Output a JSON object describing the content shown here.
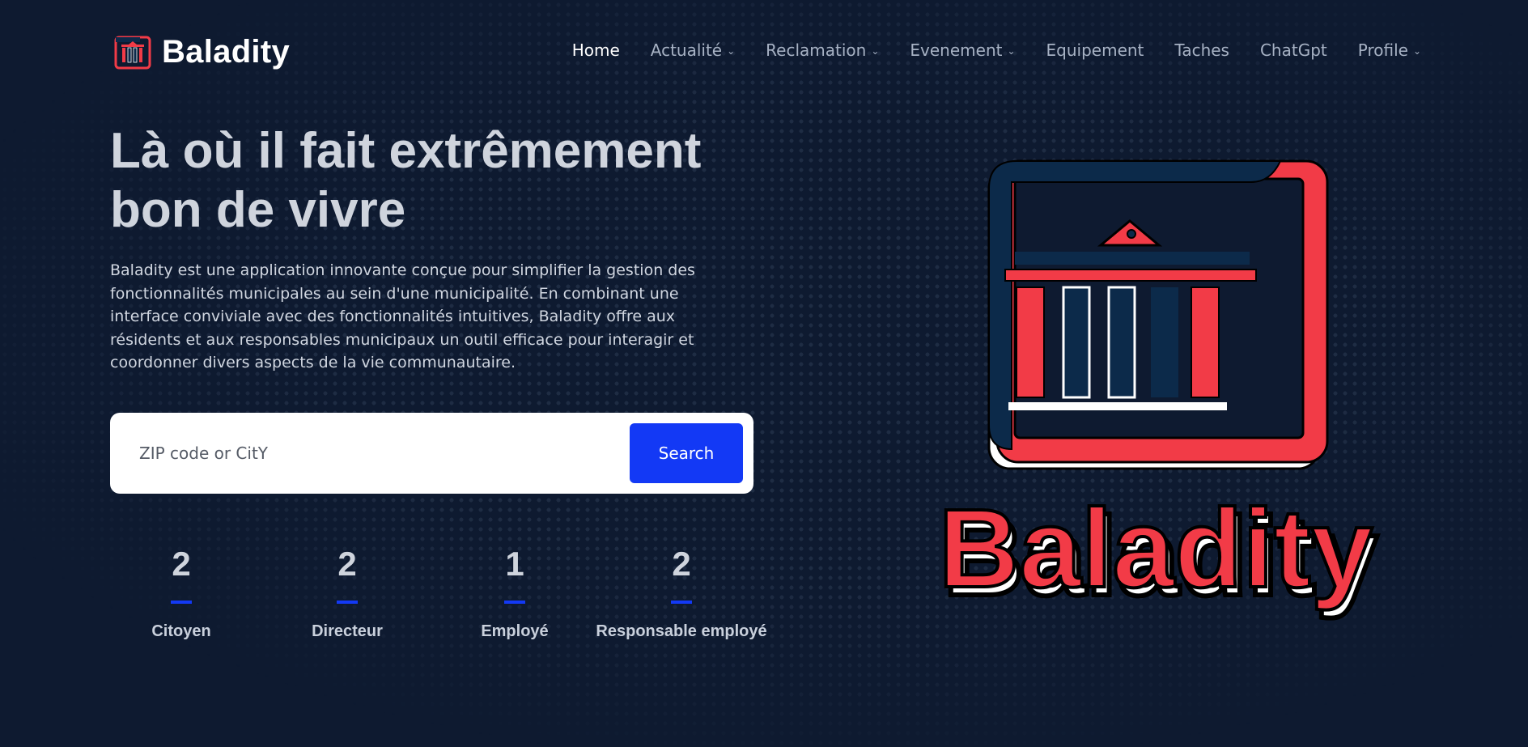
{
  "brand": {
    "name": "Baladity",
    "logo_icon": "city-hall-icon"
  },
  "nav": {
    "items": [
      {
        "label": "Home",
        "active": true,
        "has_dropdown": false
      },
      {
        "label": "Actualité",
        "active": false,
        "has_dropdown": true
      },
      {
        "label": "Reclamation",
        "active": false,
        "has_dropdown": true
      },
      {
        "label": "Evenement",
        "active": false,
        "has_dropdown": true
      },
      {
        "label": "Equipement",
        "active": false,
        "has_dropdown": false
      },
      {
        "label": "Taches",
        "active": false,
        "has_dropdown": false
      },
      {
        "label": "ChatGpt",
        "active": false,
        "has_dropdown": false
      },
      {
        "label": "Profile",
        "active": false,
        "has_dropdown": true
      }
    ]
  },
  "hero": {
    "title_line1": "Là où il fait extrêmement",
    "title_line2": "bon de vivre",
    "description": "Baladity est une application innovante conçue pour simplifier la gestion des fonctionnalités municipales au sein d'une municipalité. En combinant une interface conviviale avec des fonctionnalités intuitives, Baladity offre aux résidents et aux responsables municipaux un outil efficace pour interagir et coordonner divers aspects de la vie communautaire."
  },
  "search": {
    "placeholder": "ZIP code or CitY",
    "value": "",
    "button_label": "Search"
  },
  "stats": [
    {
      "value": "2",
      "label": "Citoyen"
    },
    {
      "value": "2",
      "label": "Directeur"
    },
    {
      "value": "1",
      "label": "Employé"
    },
    {
      "value": "2",
      "label": "Responsable employé"
    }
  ],
  "hero_logo": {
    "wordmark": "Baladity"
  },
  "colors": {
    "background": "#0e1a30",
    "accent_blue": "#1339f5",
    "logo_red": "#f23b47",
    "logo_navy": "#0c2a4a"
  }
}
